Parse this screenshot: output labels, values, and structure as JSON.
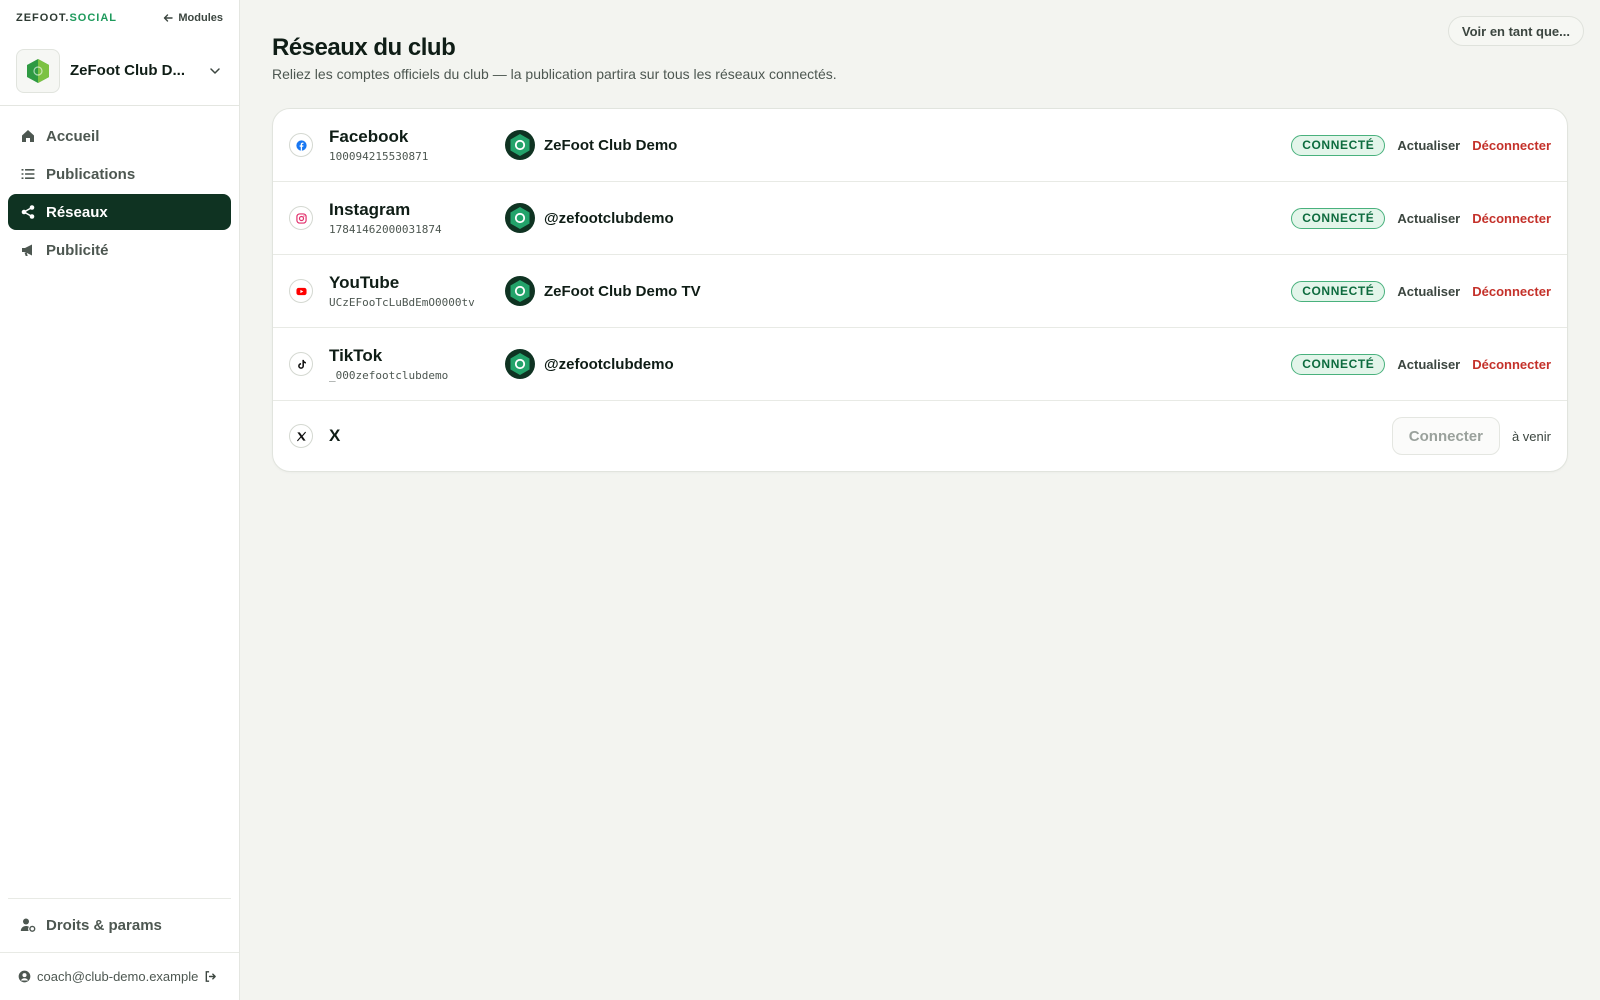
{
  "brand": {
    "main": "ZEFOOT.",
    "accent": "SOCIAL"
  },
  "topbar": {
    "modules_label": "Modules"
  },
  "club": {
    "name": "ZeFoot Club D..."
  },
  "nav": {
    "items": [
      {
        "label": "Accueil",
        "icon": "home-icon"
      },
      {
        "label": "Publications",
        "icon": "list-icon"
      },
      {
        "label": "Réseaux",
        "icon": "share-icon",
        "active": true
      },
      {
        "label": "Publicité",
        "icon": "megaphone-icon"
      }
    ],
    "settings_label": "Droits & params"
  },
  "user": {
    "email": "coach@club-demo.example"
  },
  "header": {
    "view_as": "Voir en tant que...",
    "title": "Réseaux du club",
    "subtitle": "Reliez les comptes officiels du club — la publication partira sur tous les réseaux connectés."
  },
  "networks": [
    {
      "name": "Facebook",
      "id": "100094215530871",
      "account": "ZeFoot Club Demo",
      "status": "CONNECTÉ",
      "refresh": "Actualiser",
      "disconnect": "Déconnecter",
      "icon_color": "#1877f2"
    },
    {
      "name": "Instagram",
      "id": "17841462000031874",
      "account": "@zefootclubdemo",
      "status": "CONNECTÉ",
      "refresh": "Actualiser",
      "disconnect": "Déconnecter",
      "icon_color": "#e1306c"
    },
    {
      "name": "YouTube",
      "id": "UCzEFooTcLuBdEmO0000tv",
      "account": "ZeFoot Club Demo TV",
      "status": "CONNECTÉ",
      "refresh": "Actualiser",
      "disconnect": "Déconnecter",
      "icon_color": "#ff0000"
    },
    {
      "name": "TikTok",
      "id": "_000zefootclubdemo",
      "account": "@zefootclubdemo",
      "status": "CONNECTÉ",
      "refresh": "Actualiser",
      "disconnect": "Déconnecter",
      "icon_color": "#111111"
    }
  ],
  "x_network": {
    "name": "X",
    "connect": "Connecter",
    "soon": "à venir"
  },
  "colors": {
    "accent": "#1e9a5c",
    "nav_active": "#0f3322",
    "danger": "#c4312a",
    "badge_bg": "#e3f5ea"
  }
}
